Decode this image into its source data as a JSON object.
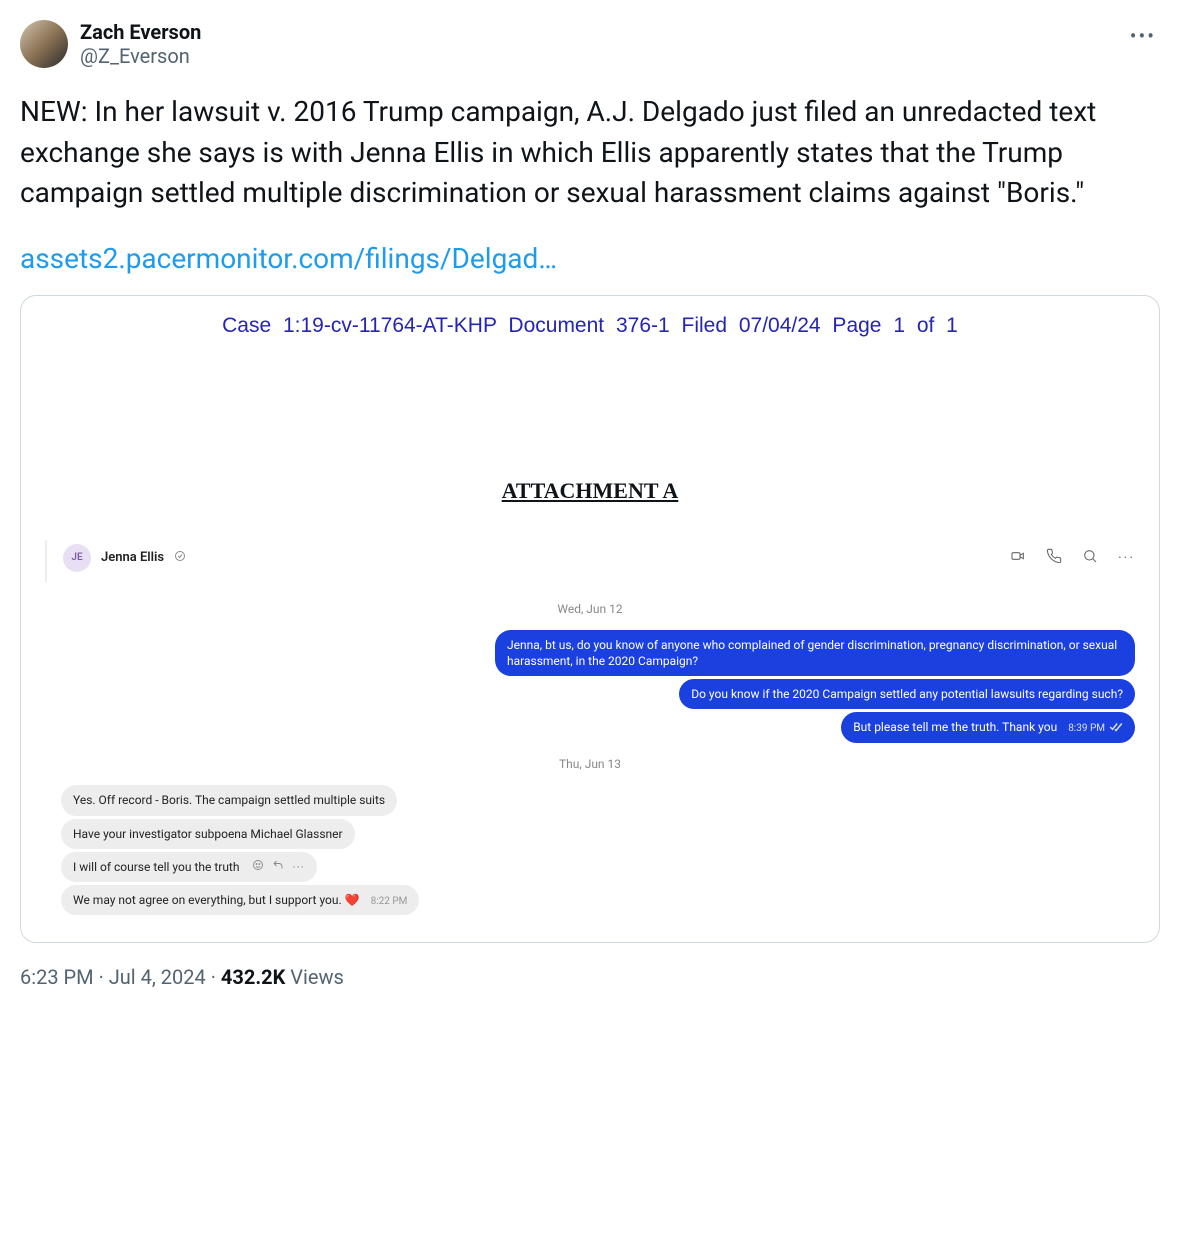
{
  "author": {
    "name": "Zach Everson",
    "handle": "@Z_Everson"
  },
  "tweet": {
    "text": "NEW: In her lawsuit v. 2016 Trump campaign, A.J. Delgado just filed an unredacted text exchange she says is with Jenna Ellis in which Ellis apparently states that the Trump campaign settled multiple discrimination or sexual harassment claims against \"Boris.\"",
    "link_text": "assets2.pacermonitor.com/filings/Delgad…"
  },
  "document": {
    "case_line": "Case 1:19-cv-11764-AT-KHP    Document 376-1    Filed 07/04/24    Page 1 of 1",
    "attachment_title": "ATTACHMENT A",
    "chat": {
      "initials": "JE",
      "name": "Jenna Ellis",
      "date1": "Wed, Jun 12",
      "sent1": "Jenna, bt us, do you know of anyone who complained of gender discrimination, pregnancy discrimination, or sexual harassment, in the 2020 Campaign?",
      "sent2": "Do you know if the 2020 Campaign settled any potential lawsuits regarding such?",
      "sent3": "But please tell me the truth. Thank you",
      "sent3_time": "8:39 PM",
      "date2": "Thu, Jun 13",
      "recv1": "Yes. Off record - Boris. The campaign settled multiple suits",
      "recv2": "Have your investigator subpoena Michael Glassner",
      "recv3": "I will of course tell you the truth",
      "recv4": "We may not agree on everything, but I support you.",
      "recv4_time": "8:22 PM"
    }
  },
  "footer": {
    "timestamp": "6:23 PM · Jul 4, 2024",
    "views_count": "432.2K",
    "views_label": "Views"
  }
}
